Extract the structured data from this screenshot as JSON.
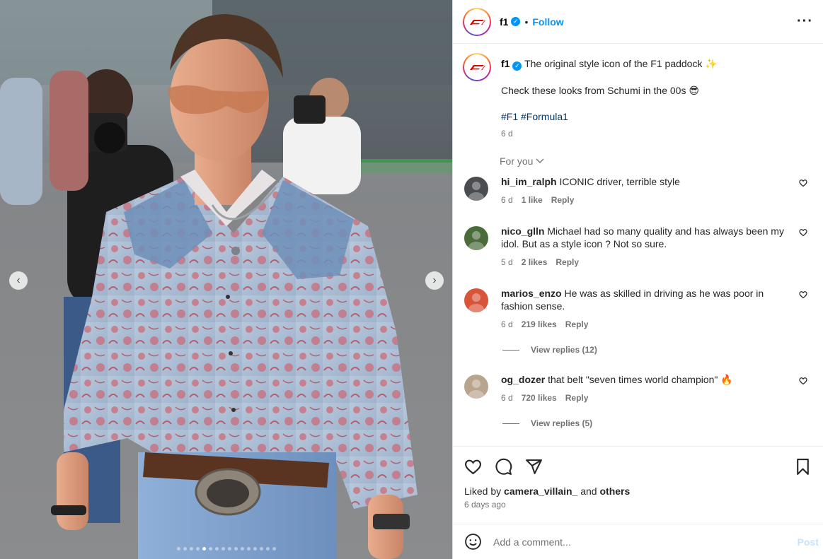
{
  "media": {
    "slide_count": 16,
    "active_slide": 5,
    "prev_icon": "chevron-left-icon",
    "next_icon": "chevron-right-icon"
  },
  "header": {
    "username": "f1",
    "verified": true,
    "separator": "•",
    "follow_label": "Follow",
    "more_icon": "more-options-icon",
    "more_label": "···"
  },
  "caption": {
    "username": "f1",
    "line1": "The original style icon of the F1 paddock ✨",
    "line2": "Check these looks from Schumi in the 00s 😎",
    "hashtags": "#F1 #Formula1",
    "time": "6 d"
  },
  "for_you": {
    "label": "For you",
    "icon": "chevron-down-icon"
  },
  "comments": [
    {
      "username": "hi_im_ralph",
      "text": "ICONIC driver, terrible style",
      "time": "6 d",
      "likes": "1 like",
      "reply": "Reply",
      "view_replies": ""
    },
    {
      "username": "nico_glln",
      "text": "Michael had so many quality and has always been my idol. But as a style icon ? Not so sure.",
      "time": "5 d",
      "likes": "2 likes",
      "reply": "Reply",
      "view_replies": ""
    },
    {
      "username": "marios_enzo",
      "text": "He was as skilled in driving as he was poor in fashion sense.",
      "time": "6 d",
      "likes": "219 likes",
      "reply": "Reply",
      "view_replies": "View replies (12)"
    },
    {
      "username": "og_dozer",
      "text": "that belt \"seven times world champion\" 🔥",
      "time": "6 d",
      "likes": "720 likes",
      "reply": "Reply",
      "view_replies": "View replies (5)"
    }
  ],
  "actions": {
    "liked_by_prefix": "Liked by ",
    "liked_by_user": "camera_villain_",
    "liked_by_and": " and ",
    "liked_by_others": "others",
    "date": "6 days ago"
  },
  "add_comment": {
    "placeholder": "Add a comment...",
    "post_label": "Post",
    "emoji_icon": "emoji-icon"
  },
  "colors": {
    "accent": "#0095f6",
    "hashtag": "#00376b",
    "muted": "#737373",
    "f1_red": "#e10600"
  }
}
